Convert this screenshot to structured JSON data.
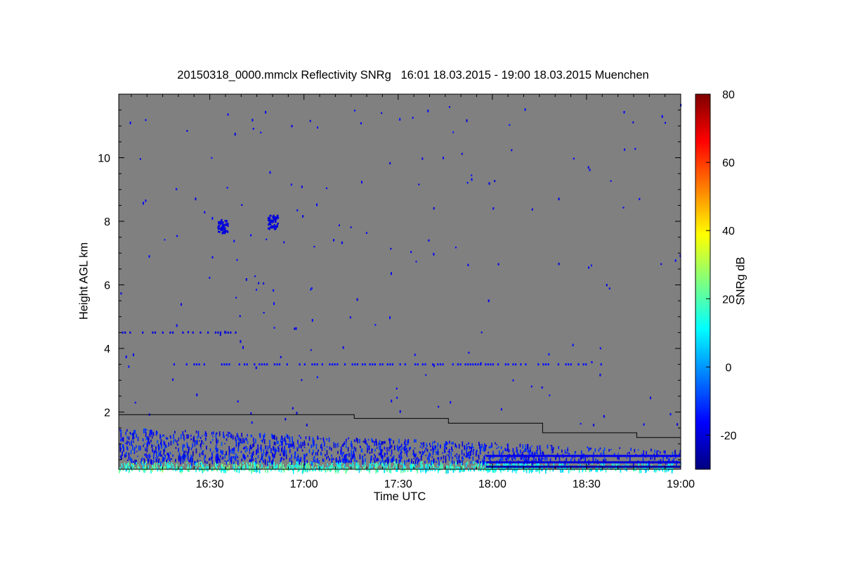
{
  "chart_data": {
    "type": "heatmap",
    "title": "20150318_0000.mmclx Reflectivity SNRg   16:01 18.03.2015 - 19:00 18.03.2015 Muenchen",
    "xlabel": "Time UTC",
    "ylabel": "Height AGL km",
    "colorbar_label": "SNRg dB",
    "x_range_min": [
      961,
      1140
    ],
    "y_range_km": [
      0.2,
      12.0
    ],
    "x_ticks": [
      {
        "min": 990,
        "label": "16:30"
      },
      {
        "min": 1020,
        "label": "17:00"
      },
      {
        "min": 1050,
        "label": "17:30"
      },
      {
        "min": 1080,
        "label": "18:00"
      },
      {
        "min": 1110,
        "label": "18:30"
      },
      {
        "min": 1140,
        "label": "19:00"
      }
    ],
    "y_ticks": [
      {
        "value": 2,
        "label": "2"
      },
      {
        "value": 4,
        "label": "4"
      },
      {
        "value": 6,
        "label": "6"
      },
      {
        "value": 8,
        "label": "8"
      },
      {
        "value": 10,
        "label": "10"
      }
    ],
    "colorbar_range": [
      -30,
      80
    ],
    "colorbar_ticks": [
      {
        "value": -20,
        "label": "-20"
      },
      {
        "value": 0,
        "label": "0"
      },
      {
        "value": 20,
        "label": "20"
      },
      {
        "value": 40,
        "label": "40"
      },
      {
        "value": 60,
        "label": "60"
      },
      {
        "value": 80,
        "label": "80"
      }
    ],
    "colormap": [
      "#00007f",
      "#0000ff",
      "#007fff",
      "#00ffff",
      "#7fff7f",
      "#ffff00",
      "#ff7f00",
      "#ff0000",
      "#7f0000"
    ],
    "background_color": "#808080",
    "boundary_layer_line_km": [
      {
        "t_start": 961,
        "t_end": 1036,
        "height": 1.92
      },
      {
        "t_start": 1036,
        "t_end": 1066,
        "height": 1.8
      },
      {
        "t_start": 1066,
        "t_end": 1096,
        "height": 1.65
      },
      {
        "t_start": 1096,
        "t_end": 1126,
        "height": 1.35
      },
      {
        "t_start": 1126,
        "t_end": 1140,
        "height": 1.2
      }
    ],
    "echo_features": [
      {
        "name": "cirrus-patch-1",
        "t": 994,
        "height": 7.85,
        "snr_db": -20
      },
      {
        "name": "cirrus-patch-2",
        "t": 1010,
        "height": 8.0,
        "snr_db": -20
      },
      {
        "name": "layer-4.5km",
        "t_start": 962,
        "t_end": 998,
        "height": 4.5,
        "snr_db": -20
      },
      {
        "name": "layer-3.5km",
        "t_start": 976,
        "t_end": 1116,
        "height": 3.5,
        "snr_db": -15
      }
    ]
  }
}
